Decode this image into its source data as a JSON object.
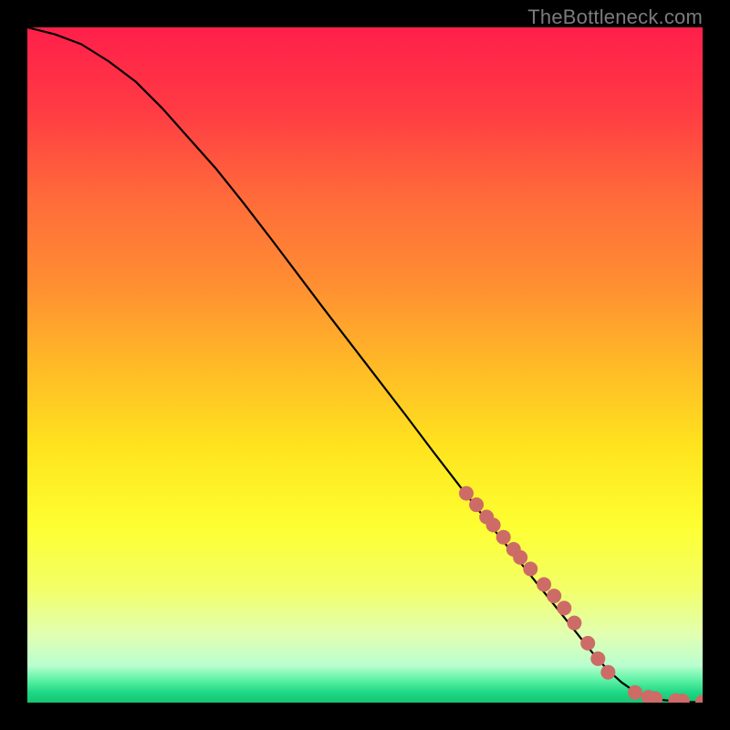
{
  "watermark": "TheBottleneck.com",
  "chart_data": {
    "type": "line",
    "title": "",
    "xlabel": "",
    "ylabel": "",
    "xlim": [
      0,
      100
    ],
    "ylim": [
      0,
      100
    ],
    "grid": false,
    "curve": {
      "name": "bottleneck-curve",
      "x": [
        0,
        4,
        8,
        12,
        16,
        20,
        24,
        28,
        32,
        36,
        40,
        44,
        48,
        52,
        56,
        60,
        64,
        68,
        72,
        76,
        80,
        84,
        86,
        88,
        90,
        92,
        94,
        96,
        98,
        100
      ],
      "y": [
        100,
        99,
        97.5,
        95,
        92,
        88,
        83.5,
        79,
        74,
        68.8,
        63.5,
        58.2,
        53,
        47.8,
        42.6,
        37.3,
        32.1,
        27,
        22,
        17,
        12,
        7,
        4.8,
        3,
        1.6,
        0.8,
        0.4,
        0.2,
        0.1,
        0.05
      ]
    },
    "markers": {
      "name": "highlighted-points",
      "color": "#cd6b67",
      "x": [
        65,
        66.5,
        68,
        69,
        70.5,
        72,
        73,
        74.5,
        76.5,
        78,
        79.5,
        81,
        83,
        84.5,
        86,
        90,
        92,
        93,
        96,
        97,
        100
      ],
      "y": [
        31,
        29.3,
        27.5,
        26.3,
        24.5,
        22.7,
        21.5,
        19.8,
        17.5,
        15.8,
        14,
        11.8,
        8.8,
        6.5,
        4.5,
        1.5,
        0.8,
        0.6,
        0.3,
        0.25,
        0.1
      ]
    },
    "gradient_stops": [
      {
        "offset": 0.0,
        "color": "#ff1f4a"
      },
      {
        "offset": 0.12,
        "color": "#ff3a44"
      },
      {
        "offset": 0.25,
        "color": "#ff6a3a"
      },
      {
        "offset": 0.38,
        "color": "#ff8e32"
      },
      {
        "offset": 0.5,
        "color": "#ffb927"
      },
      {
        "offset": 0.62,
        "color": "#ffe31e"
      },
      {
        "offset": 0.74,
        "color": "#fdff32"
      },
      {
        "offset": 0.83,
        "color": "#f3ff67"
      },
      {
        "offset": 0.9,
        "color": "#e1ffb2"
      },
      {
        "offset": 0.945,
        "color": "#b9ffcf"
      },
      {
        "offset": 0.965,
        "color": "#63f3a8"
      },
      {
        "offset": 0.985,
        "color": "#1fd884"
      },
      {
        "offset": 1.0,
        "color": "#14c573"
      }
    ]
  }
}
